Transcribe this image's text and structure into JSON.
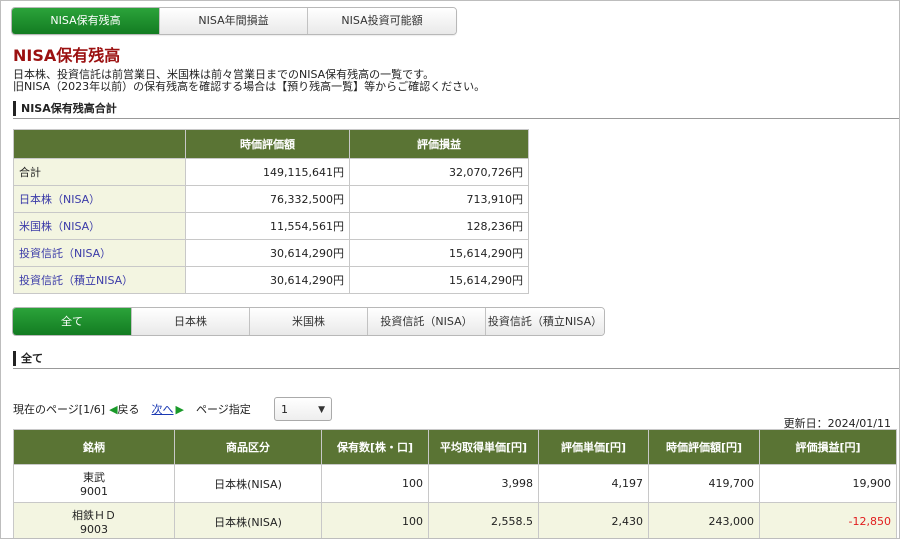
{
  "top_tabs": [
    {
      "label": "NISA保有残高",
      "active": true
    },
    {
      "label": "NISA年間損益",
      "active": false
    },
    {
      "label": "NISA投資可能額",
      "active": false
    }
  ],
  "page_title": "NISA保有残高",
  "description": [
    "日本株、投資信託は前営業日、米国株は前々営業日までのNISA保有残高の一覧です。",
    "旧NISA（2023年以前）の保有残高を確認する場合は【預り残高一覧】等からご確認ください。"
  ],
  "summary_section_title": "NISA保有残高合計",
  "summary": {
    "headers": [
      "",
      "時価評価額",
      "評価損益"
    ],
    "rows": [
      {
        "label": "合計",
        "market_value": "149,115,641円",
        "pl": "32,070,726円"
      },
      {
        "label": "日本株（NISA）",
        "market_value": "76,332,500円",
        "pl": "713,910円"
      },
      {
        "label": "米国株（NISA）",
        "market_value": "11,554,561円",
        "pl": "128,236円"
      },
      {
        "label": "投資信託（NISA）",
        "market_value": "30,614,290円",
        "pl": "15,614,290円"
      },
      {
        "label": "投資信託（積立NISA）",
        "market_value": "30,614,290円",
        "pl": "15,614,290円"
      }
    ]
  },
  "filter_tabs": [
    {
      "label": "全て",
      "active": true
    },
    {
      "label": "日本株",
      "active": false
    },
    {
      "label": "米国株",
      "active": false
    },
    {
      "label": "投資信託（NISA）",
      "active": false
    },
    {
      "label": "投資信託（積立NISA）",
      "active": false
    }
  ],
  "list_section_title": "全て",
  "pager": {
    "current_label": "現在のページ[1/6]",
    "prev_label": "戻る",
    "next_label": "次へ",
    "page_select_label": "ページ指定",
    "page_value": "1"
  },
  "updated": "更新日：2024/01/11",
  "holdings": {
    "headers": [
      "銘柄",
      "商品区分",
      "保有数[株・口]",
      "平均取得単価[円]",
      "評価単価[円]",
      "時価評価額[円]",
      "評価損益[円]"
    ],
    "rows": [
      {
        "name": "東武",
        "code": "9001",
        "category": "日本株(NISA)",
        "quantity": "100",
        "avg_cost": "3,998",
        "price": "4,197",
        "market_value": "419,700",
        "pl": "19,900"
      },
      {
        "name": "相鉄ＨＤ",
        "code": "9003",
        "category": "日本株(NISA)",
        "quantity": "100",
        "avg_cost": "2,558.5",
        "price": "2,430",
        "market_value": "243,000",
        "pl": "-12,850"
      }
    ]
  },
  "colors": {
    "accent_green": "#1a8c2c",
    "header_olive": "#5a7434",
    "title_red": "#9b1010",
    "negative": "#e11d1d"
  }
}
